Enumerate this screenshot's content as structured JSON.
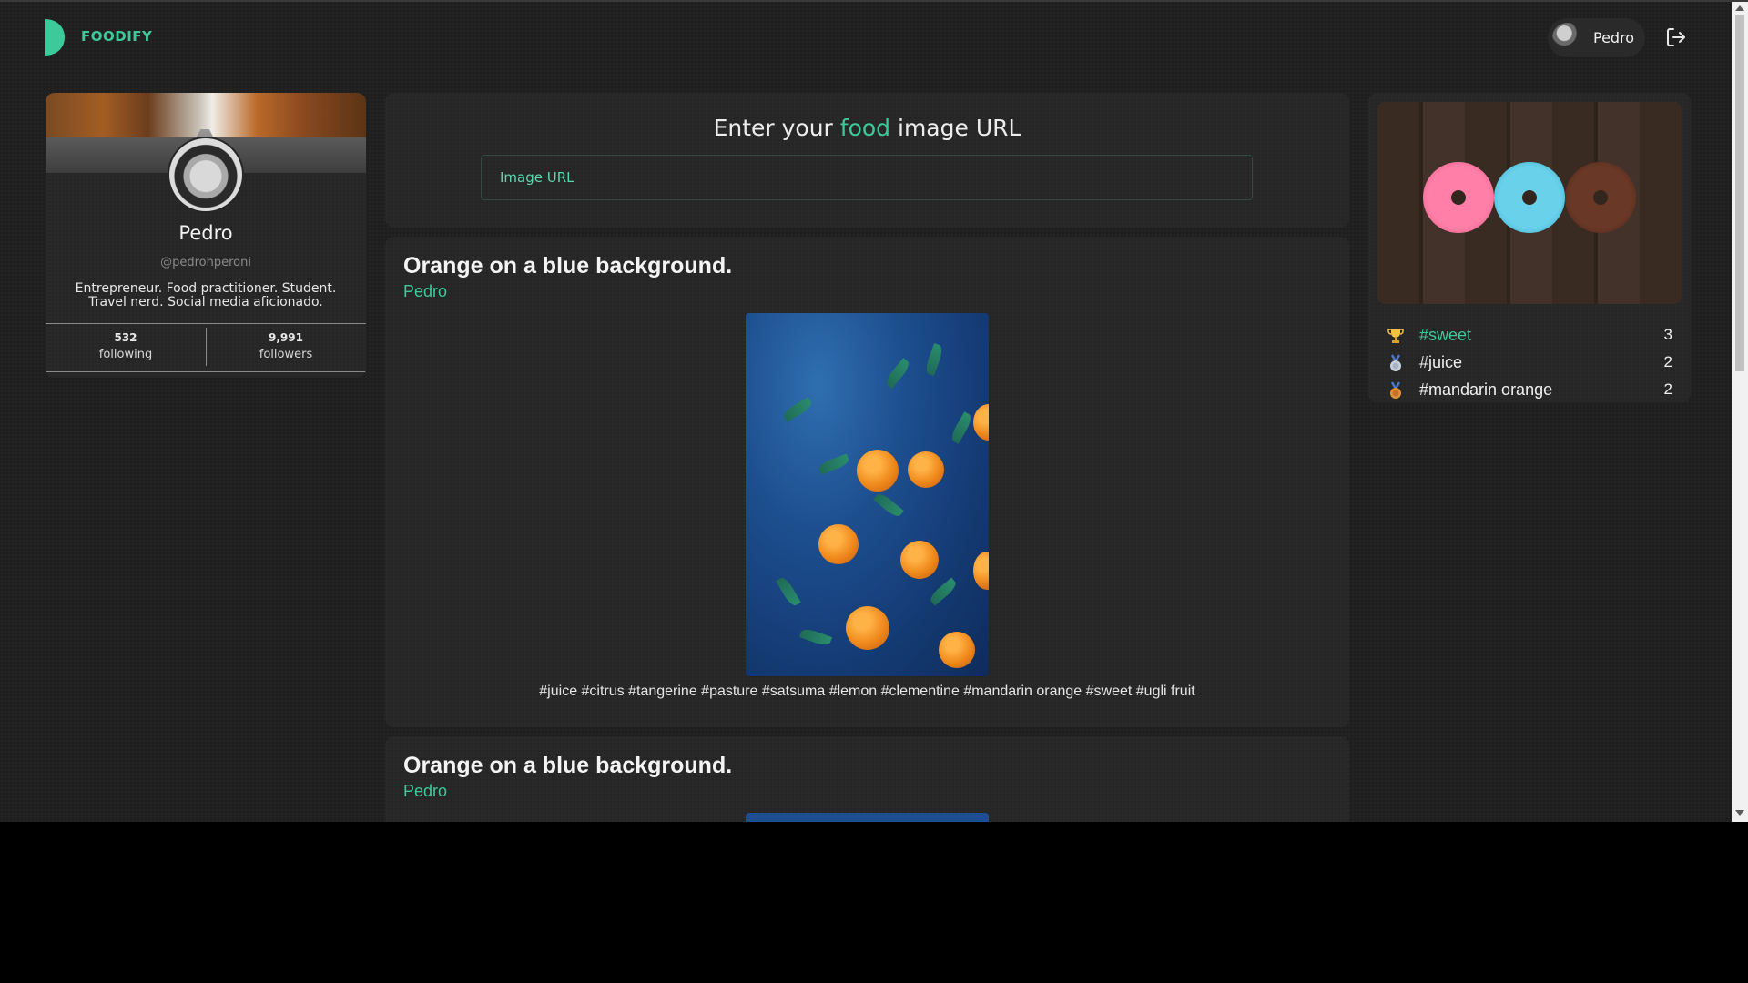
{
  "app": {
    "brand": "FOODIFY",
    "accent": "#3ec99b"
  },
  "header": {
    "user_name": "Pedro",
    "logout_icon": "logout-icon"
  },
  "profile": {
    "name": "Pedro",
    "handle": "@pedrohperoni",
    "bio": "Entrepreneur. Food practitioner. Student. Travel nerd. Social media aficionado.",
    "following_count": "532",
    "following_label": "following",
    "followers_count": "9,991",
    "followers_label": "followers"
  },
  "url_form": {
    "heading_prefix": "Enter your",
    "heading_highlight": "food",
    "heading_suffix": "image URL",
    "placeholder": "Image URL"
  },
  "posts": [
    {
      "title": "Orange on a blue background.",
      "author": "Pedro",
      "tags": "#juice #citrus #tangerine #pasture #satsuma #lemon #clementine #mandarin orange #sweet #ugli fruit"
    },
    {
      "title": "Orange on a blue background.",
      "author": "Pedro"
    }
  ],
  "trending": {
    "items": [
      {
        "icon": "trophy-icon",
        "tag": "#sweet",
        "count": "3",
        "color": "#3ec99b"
      },
      {
        "icon": "silver-medal-icon",
        "tag": "#juice",
        "count": "2",
        "color": "#f0f0f0"
      },
      {
        "icon": "bronze-medal-icon",
        "tag": "#mandarin orange",
        "count": "2",
        "color": "#f0f0f0"
      }
    ]
  }
}
